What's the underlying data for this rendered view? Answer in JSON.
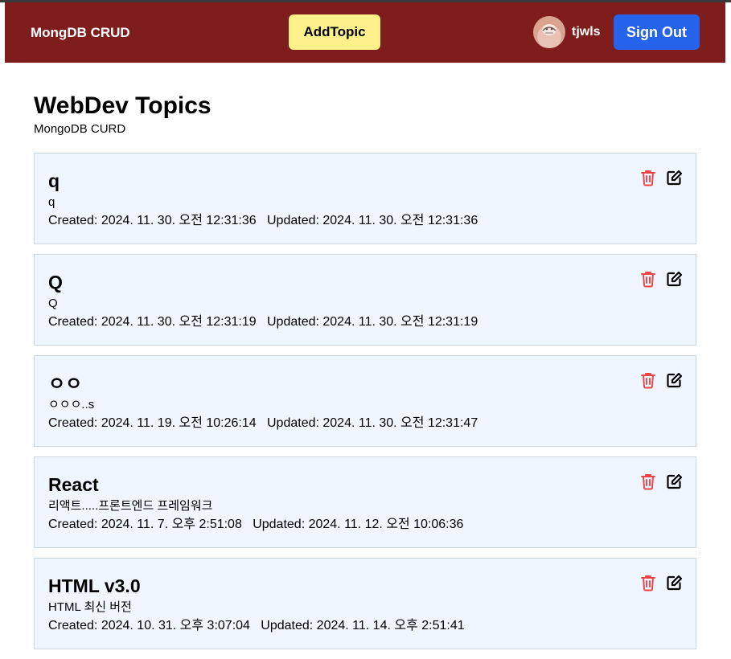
{
  "header": {
    "brand": "MongDB CRUD",
    "add_topic_label": "AddTopic",
    "username": "tjwls",
    "sign_out_label": "Sign Out"
  },
  "page": {
    "title": "WebDev Topics",
    "subtitle": "MongoDB CURD"
  },
  "topics": [
    {
      "title": "q",
      "description": "q",
      "created_label": "Created: 2024. 11. 30. 오전 12:31:36",
      "updated_label": "Updated: 2024. 11. 30. 오전 12:31:36"
    },
    {
      "title": "Q",
      "description": "Q",
      "created_label": "Created: 2024. 11. 30. 오전 12:31:19",
      "updated_label": "Updated: 2024. 11. 30. 오전 12:31:19"
    },
    {
      "title": "ㅇㅇ",
      "description": "ㅇㅇㅇ..s",
      "created_label": "Created: 2024. 11. 19. 오전 10:26:14",
      "updated_label": "Updated: 2024. 11. 30. 오전 12:31:47"
    },
    {
      "title": "React",
      "description": "리액트.....프론트엔드 프레임워크",
      "created_label": "Created: 2024. 11. 7. 오후 2:51:08",
      "updated_label": "Updated: 2024. 11. 12. 오전 10:06:36"
    },
    {
      "title": "HTML v3.0",
      "description": "HTML 최신 버전",
      "created_label": "Created: 2024. 10. 31. 오후 3:07:04",
      "updated_label": "Updated: 2024. 11. 14. 오후 2:51:41"
    }
  ],
  "icons": {
    "delete": "trash-icon",
    "edit": "edit-icon"
  },
  "colors": {
    "navbar": "#7f1d1d",
    "add_button": "#fef08a",
    "sign_out_button": "#2563eb",
    "card_background": "#eff6ff",
    "delete_icon": "#ef4444"
  }
}
